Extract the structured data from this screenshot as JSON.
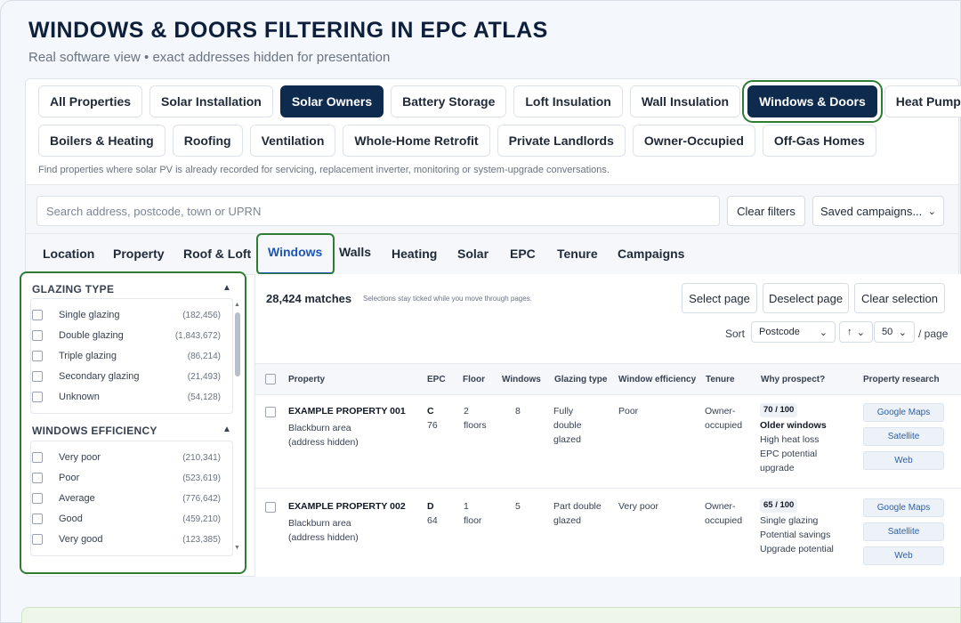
{
  "header": {
    "title": "WINDOWS & DOORS FILTERING IN EPC ATLAS",
    "subtitle": "Real software view • exact addresses hidden for presentation"
  },
  "segments_row1": [
    "All Properties",
    "Solar Installation",
    "Solar Owners",
    "Battery Storage",
    "Loft Insulation",
    "Wall Insulation",
    "Windows & Doors",
    "Heat Pumps"
  ],
  "segments_row2": [
    "Boilers & Heating",
    "Roofing",
    "Ventilation",
    "Whole-Home Retrofit",
    "Private Landlords",
    "Owner-Occupied",
    "Off-Gas Homes"
  ],
  "segment_hint": "Find properties where solar PV is already recorded for servicing, replacement inverter, monitoring or system-upgrade conversations.",
  "search": {
    "placeholder": "Search address, postcode, town or UPRN",
    "clear_label": "Clear filters",
    "saved_label": "Saved campaigns..."
  },
  "tabs": [
    "Location",
    "Property",
    "Roof & Loft",
    "Windows",
    "Walls",
    "Heating",
    "Solar",
    "EPC",
    "Tenure",
    "Campaigns"
  ],
  "filters": {
    "glazing_title": "GLAZING TYPE",
    "glazing": [
      {
        "label": "Single glazing",
        "count": "(182,456)"
      },
      {
        "label": "Double glazing",
        "count": "(1,843,672)"
      },
      {
        "label": "Triple glazing",
        "count": "(86,214)"
      },
      {
        "label": "Secondary glazing",
        "count": "(21,493)"
      },
      {
        "label": "Unknown",
        "count": "(54,128)"
      }
    ],
    "efficiency_title": "WINDOWS EFFICIENCY",
    "efficiency": [
      {
        "label": "Very poor",
        "count": "(210,341)"
      },
      {
        "label": "Poor",
        "count": "(523,619)"
      },
      {
        "label": "Average",
        "count": "(776,642)"
      },
      {
        "label": "Good",
        "count": "(459,210)"
      },
      {
        "label": "Very good",
        "count": "(123,385)"
      }
    ]
  },
  "results": {
    "matches": "28,424 matches",
    "note": "Selections stay ticked while you move through pages.",
    "select_page": "Select page",
    "deselect_page": "Deselect page",
    "clear_selection": "Clear selection",
    "sort_label": "Sort",
    "sort_value": "Postcode",
    "sort_dir": "↑",
    "page_size": "50",
    "per_page": "/ page",
    "columns": [
      "Property",
      "EPC",
      "Floor",
      "Windows",
      "Glazing type",
      "Window efficiency",
      "Tenure",
      "Why prospect?",
      "Property research"
    ],
    "rows": [
      {
        "name": "EXAMPLE PROPERTY 001",
        "area": "Blackburn area",
        "hidden": "(address hidden)",
        "epc": "C",
        "epc_score": "76",
        "floors_n": "2",
        "floors_l": "floors",
        "windows": "8",
        "glazing": [
          "Fully",
          "double",
          "glazed"
        ],
        "efficiency": "Poor",
        "tenure": [
          "Owner-",
          "occupied"
        ],
        "score": "70 / 100",
        "reasons": [
          "Older windows",
          "High heat loss",
          "EPC potential",
          "upgrade"
        ],
        "links": [
          "Google Maps",
          "Satellite",
          "Web"
        ]
      },
      {
        "name": "EXAMPLE PROPERTY 002",
        "area": "Blackburn area",
        "hidden": "(address hidden)",
        "epc": "D",
        "epc_score": "64",
        "floors_n": "1",
        "floors_l": "floor",
        "windows": "5",
        "glazing": [
          "Part double",
          "glazed"
        ],
        "efficiency": "Very poor",
        "tenure": [
          "Owner-",
          "occupied"
        ],
        "score": "65 / 100",
        "reasons": [
          "Single glazing",
          "Potential savings",
          "Upgrade potential"
        ],
        "links": [
          "Google Maps",
          "Satellite",
          "Web"
        ]
      }
    ]
  },
  "colors": {
    "navy": "#0e2a4d",
    "highlight_green": "#2e7d32",
    "link_blue": "#1d56b4"
  }
}
